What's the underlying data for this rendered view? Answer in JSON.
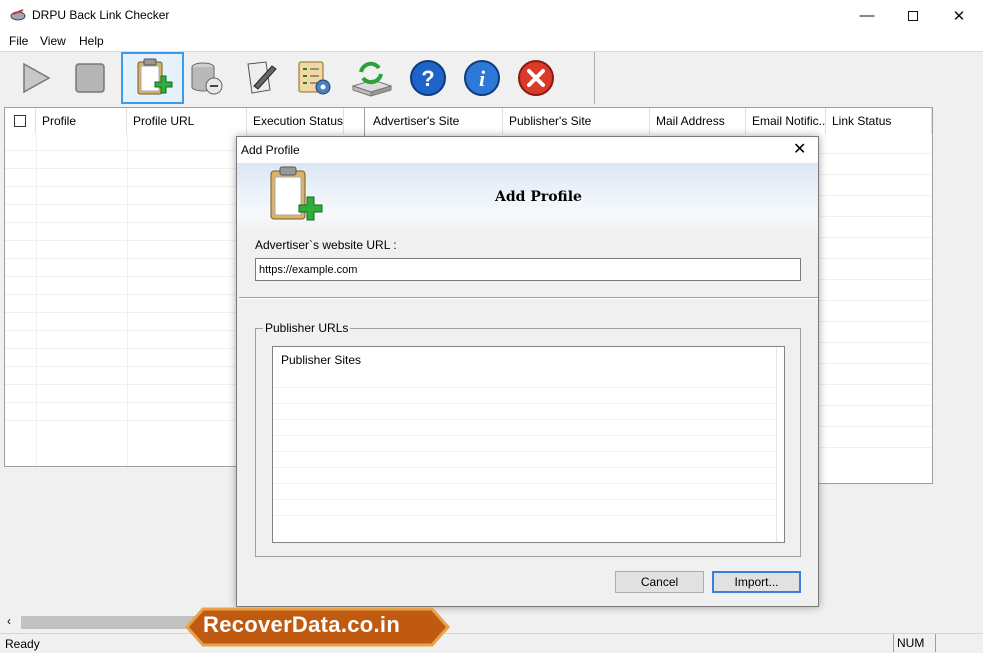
{
  "window": {
    "title": "DRPU Back Link Checker",
    "minimize_icon": "minimize-icon",
    "maximize_icon": "maximize-icon",
    "close_icon": "close-icon"
  },
  "menu": [
    "File",
    "View",
    "Help"
  ],
  "toolbar": {
    "buttons": [
      {
        "name": "start-button",
        "icon": "play-icon",
        "selected": false
      },
      {
        "name": "stop-button",
        "icon": "stop-icon",
        "selected": false
      },
      {
        "name": "add-profile-button",
        "icon": "clipboard-add-icon",
        "selected": true
      },
      {
        "name": "delete-profile-button",
        "icon": "database-delete-icon",
        "selected": false
      },
      {
        "name": "edit-profile-button",
        "icon": "document-edit-icon",
        "selected": false
      },
      {
        "name": "settings-button",
        "icon": "settings-checklist-icon",
        "selected": false
      },
      {
        "name": "update-button",
        "icon": "refresh-drive-icon",
        "selected": false
      },
      {
        "name": "help-button",
        "icon": "help-icon",
        "selected": false
      },
      {
        "name": "about-button",
        "icon": "info-icon",
        "selected": false
      },
      {
        "name": "exit-button",
        "icon": "exit-icon",
        "selected": false
      }
    ]
  },
  "left_table": {
    "columns": [
      "Profile",
      "Profile URL",
      "Execution Status"
    ]
  },
  "right_table": {
    "columns": [
      "Advertiser's Site",
      "Publisher's Site",
      "Mail Address",
      "Email Notific...",
      "Link Status"
    ]
  },
  "dialog": {
    "title": "Add Profile",
    "heading": "Add Profile",
    "advertiser_label": "Advertiser`s website URL :",
    "advertiser_value": "https://example.com",
    "publisher_group_label": "Publisher URLs",
    "publisher_list_header": "Publisher Sites",
    "cancel_label": "Cancel",
    "import_label": "Import..."
  },
  "status": {
    "text": "Ready",
    "num": "NUM"
  },
  "watermark": {
    "text": "RecoverData.co.in"
  },
  "colors": {
    "accent": "#3d9be9",
    "watermark_fill": "#c05a10",
    "watermark_border": "#e8a24a"
  }
}
